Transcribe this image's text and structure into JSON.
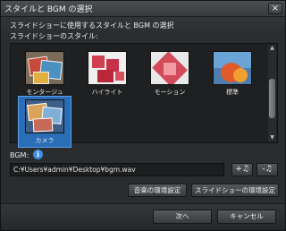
{
  "window": {
    "title": "スタイルと BGM の選択",
    "close_glyph": "×"
  },
  "description": "スライドショーに使用するスタイルと BGM の選択",
  "style_label": "スライドショーのスタイル:",
  "styles": [
    {
      "label": "モンタージュ",
      "selected": false
    },
    {
      "label": "ハイライト",
      "selected": false
    },
    {
      "label": "モーション",
      "selected": false
    },
    {
      "label": "標準",
      "selected": false
    },
    {
      "label": "カメラ",
      "selected": true
    }
  ],
  "scrollbar": {
    "up_glyph": "▲",
    "down_glyph": "▼"
  },
  "bgm": {
    "label": "BGM:",
    "info_glyph": "i",
    "path": "C:¥Users¥admin¥Desktop¥bgm.wav",
    "add_glyph": "+♫",
    "remove_glyph": "-♫"
  },
  "buttons": {
    "music_settings": "音楽の環境設定",
    "slideshow_settings": "スライドショーの環境設定",
    "next": "次へ",
    "cancel": "キャンセル"
  },
  "colors": {
    "selection": "#2a6eb8",
    "info": "#3f8fe0",
    "background": "#2a2c2e"
  }
}
